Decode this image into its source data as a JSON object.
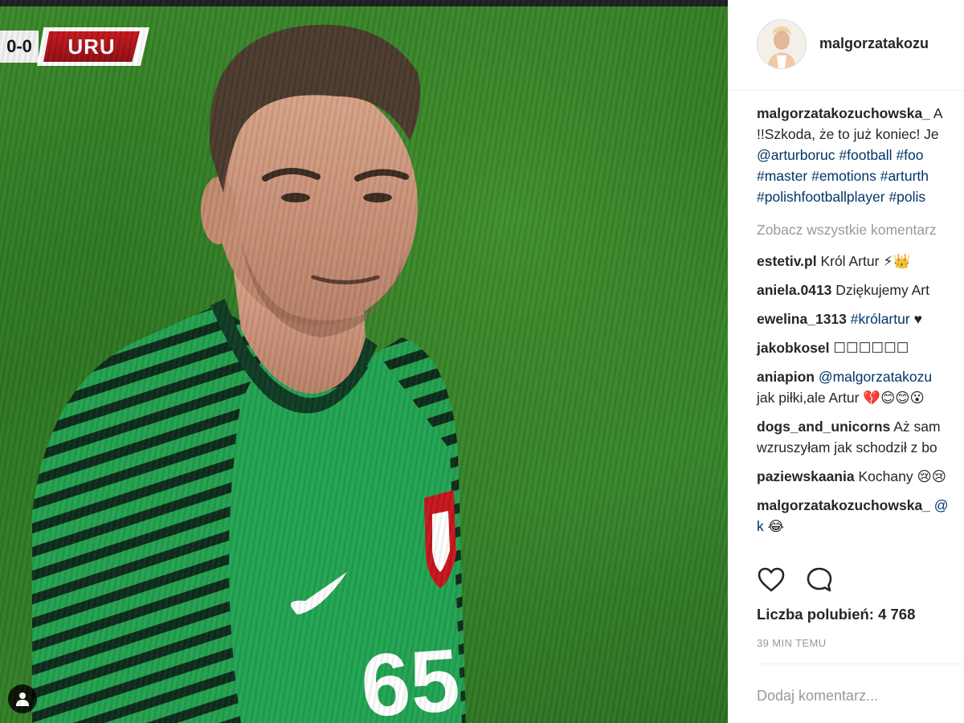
{
  "photo": {
    "scoreboard": {
      "score": "0-0",
      "team": "URU"
    },
    "jersey_number": "65"
  },
  "post": {
    "header_username": "malgorzatakozu",
    "caption": {
      "username": "malgorzatakozuchowska_",
      "text_start": "A",
      "line2": "!!Szkoda, że to już koniec! Je",
      "line3": [
        "@arturboruc",
        "#football",
        "#foo"
      ],
      "line4": [
        "#master",
        "#emotions",
        "#arturth"
      ],
      "line5": [
        "#polishfootballplayer",
        "#polis"
      ]
    },
    "view_all_comments": "Zobacz wszystkie komentarz",
    "comments": [
      {
        "user": "estetiv.pl",
        "text": "Król Artur ⚡👑"
      },
      {
        "user": "aniela.0413",
        "text": "Dziękujemy Art"
      },
      {
        "user": "ewelina_1313",
        "tag": "#królartur",
        "text": "♥"
      },
      {
        "user": "jakobkosel",
        "text": "☐☐☐☐☐☐"
      },
      {
        "user": "aniapion",
        "tag": "@malgorzatakozu",
        "line2": "jak piłki,ale Artur 💔😊😊😮"
      },
      {
        "user": "dogs_and_unicorns",
        "text": "Aż sam",
        "line2": "wzruszyłam jak schodził z bo"
      },
      {
        "user": "paziewskaania",
        "text": "Kochany 😢😢"
      },
      {
        "user": "malgorzatakozuchowska_",
        "tag": "@",
        "line2_tag": "k",
        "line2": "😂"
      }
    ],
    "actions": {
      "like_icon": "heart-icon",
      "comment_icon": "comment-bubble-icon"
    },
    "likes": "Liczba polubień: 4 768",
    "time": "39 MIN TEMU",
    "add_comment_placeholder": "Dodaj komentarz..."
  },
  "colors": {
    "link": "#003569",
    "muted": "#999999",
    "text": "#262626",
    "jersey": "#1f9a4a",
    "scoreboard_red": "#c4161c"
  }
}
